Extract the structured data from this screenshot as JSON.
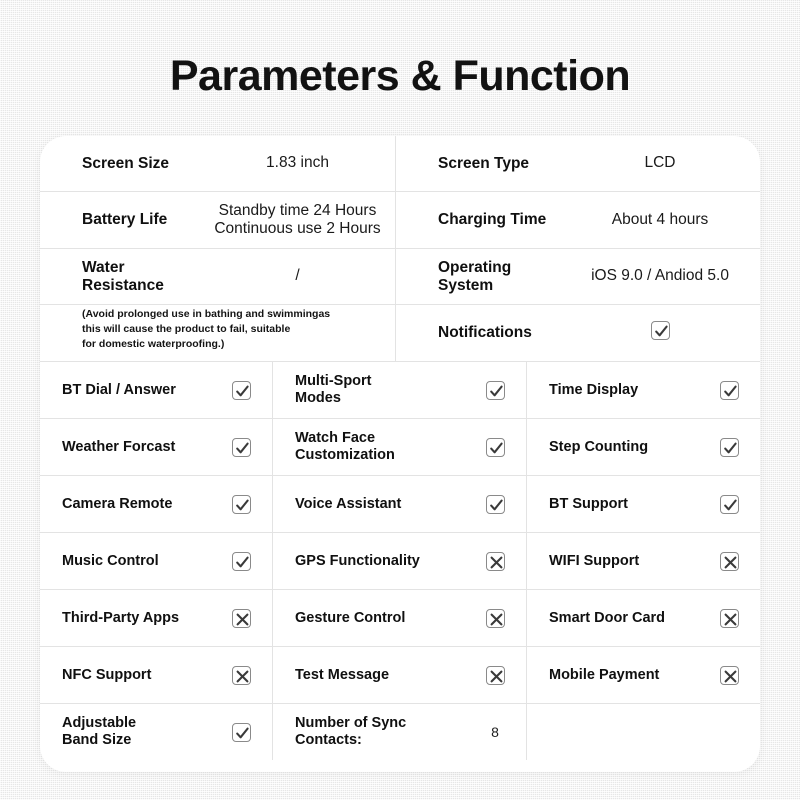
{
  "page": {
    "title": "Parameters & Function",
    "background_color": "#f2f2f2",
    "card_color": "#ffffff",
    "text_color": "#101010",
    "divider_color": "#e3e3e3",
    "mark_border_color": "#8a8a8a"
  },
  "spec": {
    "left": [
      {
        "label": "Screen Size",
        "value": "1.83 inch"
      },
      {
        "label": "Battery Life",
        "value_line1": "Standby time 24 Hours",
        "value_line2": "Continuous use 2 Hours"
      },
      {
        "label_line1": "Water",
        "label_line2": "Resistance",
        "value": "/"
      }
    ],
    "water_note": {
      "line1": "(Avoid prolonged use in bathing and swimmingas",
      "line2": "this will cause the product to fail, suitable",
      "line3": "for domestic waterproofing.)"
    },
    "right": [
      {
        "label": "Screen Type",
        "value": "LCD"
      },
      {
        "label": "Charging Time",
        "value": "About 4 hours"
      },
      {
        "label_line1": "Operating",
        "label_line2": "System",
        "value": "iOS 9.0 / Andiod 5.0"
      },
      {
        "label": "Notifications",
        "mark": "check"
      }
    ]
  },
  "features": {
    "rows": [
      [
        {
          "label": "BT Dial / Answer",
          "mark": "check"
        },
        {
          "label_line1": "Multi-Sport",
          "label_line2": "Modes",
          "mark": "check"
        },
        {
          "label": "Time Display",
          "mark": "check"
        }
      ],
      [
        {
          "label": "Weather Forcast",
          "mark": "check"
        },
        {
          "label_line1": "Watch Face",
          "label_line2": "Customization",
          "mark": "check"
        },
        {
          "label": "Step Counting",
          "mark": "check"
        }
      ],
      [
        {
          "label": "Camera Remote",
          "mark": "check"
        },
        {
          "label": "Voice Assistant",
          "mark": "check"
        },
        {
          "label": "BT Support",
          "mark": "check"
        }
      ],
      [
        {
          "label": "Music Control",
          "mark": "check"
        },
        {
          "label": "GPS Functionality",
          "mark": "cross"
        },
        {
          "label": "WIFI Support",
          "mark": "cross"
        }
      ],
      [
        {
          "label": "Third-Party Apps",
          "mark": "cross"
        },
        {
          "label": "Gesture Control",
          "mark": "cross"
        },
        {
          "label": "Smart Door Card",
          "mark": "cross"
        }
      ],
      [
        {
          "label": "NFC Support",
          "mark": "cross"
        },
        {
          "label": "Test Message",
          "mark": "cross"
        },
        {
          "label": "Mobile Payment",
          "mark": "cross"
        }
      ],
      [
        {
          "label_line1": "Adjustable",
          "label_line2": "Band Size",
          "mark": "check"
        },
        {
          "label_line1": "Number of Sync",
          "label_line2": "Contacts:",
          "number": "8"
        },
        {
          "label": "",
          "mark": "none"
        }
      ]
    ]
  }
}
